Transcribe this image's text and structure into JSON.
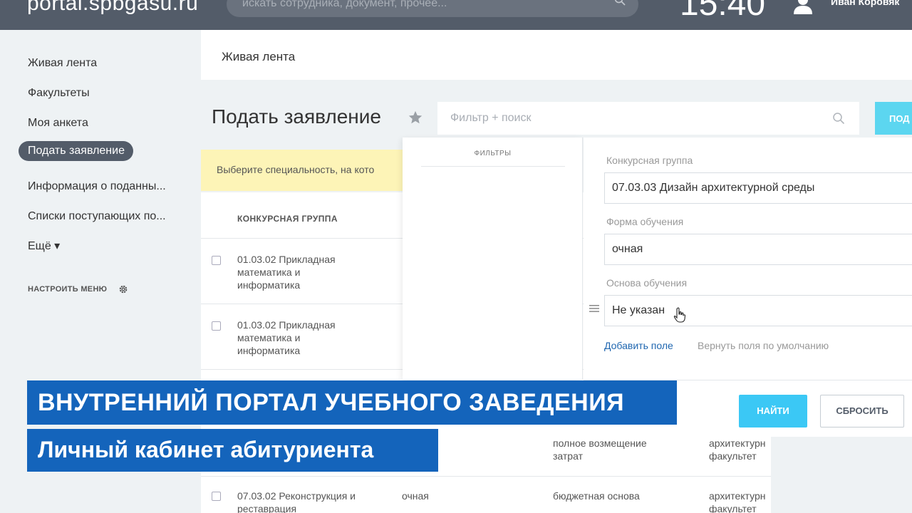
{
  "topbar": {
    "logo": "portal.spbgasu.ru",
    "search_placeholder": "искать сотрудника, документ, прочее...",
    "clock": "15:40",
    "user_name": "Иван Коровяк"
  },
  "left_menu": {
    "items": [
      {
        "label": "Живая лента"
      },
      {
        "label": "Факультеты"
      },
      {
        "label": "Моя анкета"
      },
      {
        "label": "Подать заявление"
      },
      {
        "label": "Информация о поданны..."
      },
      {
        "label": "Списки поступающих по..."
      }
    ],
    "more_label": "Ещё ▾",
    "configure_label": "НАСТРОИТЬ МЕНЮ"
  },
  "feed_header": {
    "title": "Живая лента"
  },
  "page": {
    "title": "Подать заявление",
    "filter_placeholder": "Фильтр + поиск",
    "submit_partial": "ПОД"
  },
  "notice": {
    "text": "Выберите специальность, на кото"
  },
  "table": {
    "header": "КОНКУРСНАЯ ГРУППА",
    "rows": [
      {
        "group": "01.03.02 Прикладная математика и информатика",
        "form": "",
        "basis": "",
        "faculty": ""
      },
      {
        "group": "01.03.02 Прикладная математика и информатика",
        "form": "",
        "basis": "",
        "faculty": ""
      },
      {
        "group": "",
        "form": "",
        "basis": "полное возмещение затрат",
        "faculty": "архитектурн факультет"
      },
      {
        "group": "07.03.02 Реконструкция и реставрация",
        "form": "очная",
        "basis": "бюджетная основа",
        "faculty": "архитектурн факультет"
      }
    ]
  },
  "filter_panel": {
    "filters_label": "ФИЛЬТРЫ",
    "fields": [
      {
        "label": "Конкурсная группа",
        "value": "07.03.03 Дизайн архитектурной среды"
      },
      {
        "label": "Форма обучения",
        "value": "очная"
      },
      {
        "label": "Основа обучения",
        "value": "Не указан"
      }
    ],
    "add_field": "Добавить поле",
    "reset_fields": "Вернуть поля по умолчанию",
    "find_button": "НАЙТИ",
    "reset_button": "СБРОСИТЬ"
  },
  "banners": {
    "line1": "ВНУТРЕННИЙ ПОРТАЛ УЧЕБНОГО ЗАВЕДЕНИЯ",
    "line2": "Личный кабинет абитуриента"
  }
}
